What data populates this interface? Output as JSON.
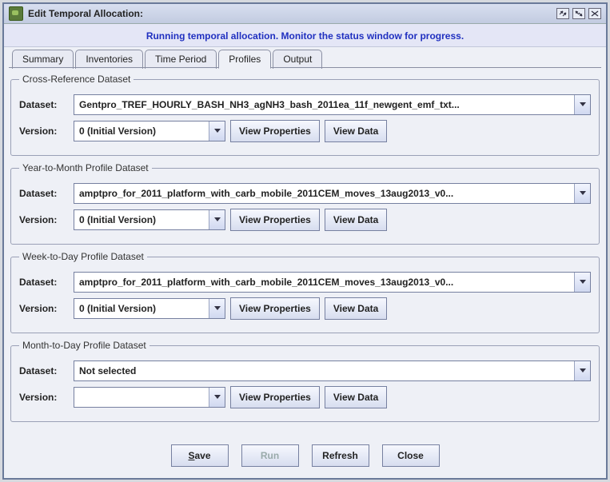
{
  "titlebar": {
    "title": "Edit Temporal Allocation:"
  },
  "status": "Running temporal allocation. Monitor the status window for progress.",
  "tabs": {
    "summary": "Summary",
    "inventories": "Inventories",
    "time_period": "Time Period",
    "profiles": "Profiles",
    "output": "Output"
  },
  "labels": {
    "dataset": "Dataset:",
    "version": "Version:",
    "view_properties": "View Properties",
    "view_data": "View Data"
  },
  "groups": {
    "cross_ref": {
      "legend": "Cross-Reference Dataset",
      "dataset": "Gentpro_TREF_HOURLY_BASH_NH3_agNH3_bash_2011ea_11f_newgent_emf_txt...",
      "version": "0 (Initial Version)"
    },
    "year_month": {
      "legend": "Year-to-Month Profile Dataset",
      "dataset": "amptpro_for_2011_platform_with_carb_mobile_2011CEM_moves_13aug2013_v0...",
      "version": "0 (Initial Version)"
    },
    "week_day": {
      "legend": "Week-to-Day Profile Dataset",
      "dataset": "amptpro_for_2011_platform_with_carb_mobile_2011CEM_moves_13aug2013_v0...",
      "version": "0 (Initial Version)"
    },
    "month_day": {
      "legend": "Month-to-Day Profile Dataset",
      "dataset": "Not selected",
      "version": ""
    }
  },
  "footer": {
    "save": "Save",
    "run": "Run",
    "refresh": "Refresh",
    "close": "Close"
  }
}
